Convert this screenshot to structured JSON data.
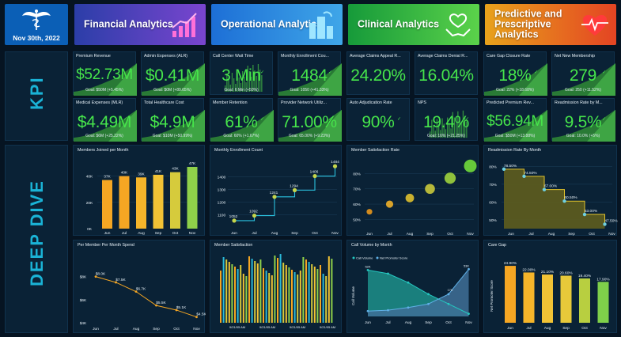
{
  "header": {
    "date": "Nov 30th, 2022",
    "tabs": [
      {
        "label": "Financial Analytics",
        "colors": [
          "#2b3ea8",
          "#7a45cf"
        ],
        "icon": "growth-chart-icon"
      },
      {
        "label": "Operational Analytics",
        "colors": [
          "#1d6fd6",
          "#3fa6e8"
        ],
        "icon": "buildings-icon"
      },
      {
        "label": "Clinical Analytics",
        "colors": [
          "#169a3a",
          "#5bd24a"
        ],
        "icon": "heart-hands-icon"
      },
      {
        "label": "Predictive and Prescriptive Analytics",
        "colors": [
          "#e8a21b",
          "#e44423"
        ],
        "icon": "heartbeat-icon"
      }
    ]
  },
  "sections": {
    "kpi": "KPI",
    "deep_dive": "DEEP DIVE"
  },
  "kpis": [
    {
      "title": "Premium Revenue",
      "value": "$52.73M",
      "goal": "Goal: $50M (+5.45%)",
      "spark": "area"
    },
    {
      "title": "Admin Expenses (ALR)",
      "value": "$0.41M",
      "goal": "Goal: $0M (+89.65%)",
      "spark": "area"
    },
    {
      "title": "Call Center Wait Time",
      "value": "3 Min",
      "goal": "Goal: 6 Min (+50%)",
      "spark": "bars"
    },
    {
      "title": "Monthly Enrollment Cou...",
      "value": "1484",
      "goal": "Goal: 1050 (+41.33%)",
      "spark": "area"
    },
    {
      "title": "Average Claims Appeal R...",
      "value": "24.20%",
      "goal": "",
      "spark": "none"
    },
    {
      "title": "Average Claims Denial R...",
      "value": "16.04%",
      "goal": "",
      "spark": "none"
    },
    {
      "title": "Care Gap Closure Rate",
      "value": "18%",
      "goal": "Goal: 22% (+18.68%)",
      "spark": "area"
    },
    {
      "title": "Net New Membership",
      "value": "279",
      "goal": "Goal: 250 (+11.52%)",
      "spark": "area"
    },
    {
      "title": "Medical Expenses (MLR)",
      "value": "$4.49M",
      "goal": "Goal: $6M (+25.22%)",
      "spark": "area"
    },
    {
      "title": "Total Healthcare Cost",
      "value": "$4.9M",
      "goal": "Goal: $10M (+50.99%)",
      "spark": "area"
    },
    {
      "title": "Member Retention",
      "value": "61%",
      "goal": "Goal: 60% (+1.67%)",
      "spark": "area"
    },
    {
      "title": "Provider Network Utiliz...",
      "value": "71.00%",
      "goal": "Goal: 65.00% (+9.23%)",
      "spark": "area"
    },
    {
      "title": "Auto Adjudication Rate",
      "value": "90%",
      "goal": "",
      "spark": "none"
    },
    {
      "title": "NPS",
      "value": "19.4%",
      "goal": "Goal: 16% (+21.25%)",
      "spark": "bars"
    },
    {
      "title": "Predicted Premium Rev...",
      "value": "$56.94M",
      "goal": "Goal: $50M (+13.88%)",
      "spark": "area"
    },
    {
      "title": "Readmission Rate by M...",
      "value": "9.5%",
      "goal": "Goal: 10.0% (+5%)",
      "spark": "area"
    }
  ],
  "chart_data": [
    {
      "id": "members-joined",
      "type": "bar",
      "title": "Members Joined per Month",
      "categories": [
        "Jun",
        "Jul",
        "Aug",
        "Sep",
        "Oct",
        "Nov"
      ],
      "values": [
        37,
        40,
        39,
        41,
        43,
        47
      ],
      "value_labels": [
        "37K",
        "40K",
        "39K",
        "41K",
        "43K",
        "47K"
      ],
      "yticks": [
        "40K",
        "20K",
        "0K"
      ],
      "ylim": [
        0,
        50
      ]
    },
    {
      "id": "monthly-enrollment",
      "type": "line",
      "title": "Monthly Enrollment Count",
      "categories": [
        "Jun",
        "Jul",
        "Aug",
        "Sep",
        "Oct",
        "Nov"
      ],
      "values": [
        1052,
        1092,
        1241,
        1294,
        1406,
        1484
      ],
      "yticks": [
        "1400",
        "1300",
        "1200",
        "1100"
      ],
      "ylim": [
        1020,
        1510
      ]
    },
    {
      "id": "member-satisfaction-rate",
      "type": "scatter",
      "title": "Member Satisfaction Rate",
      "categories": [
        "Jun",
        "Jul",
        "Aug",
        "Sep",
        "Oct",
        "Nov"
      ],
      "values": [
        55,
        60,
        64,
        70,
        77,
        85
      ],
      "yticks": [
        "80%",
        "70%",
        "60%",
        "50%"
      ],
      "ylim": [
        45,
        88
      ]
    },
    {
      "id": "readmission-rate",
      "type": "area",
      "title": "Readmission Rate By Month",
      "categories": [
        "Jun",
        "Jul",
        "Aug",
        "Sep",
        "Oct",
        "Nov"
      ],
      "values": [
        78.5,
        74.5,
        67.0,
        60.5,
        53.0,
        47.5
      ],
      "value_labels": [
        "78.50%",
        "74.50%",
        "67.00%",
        "60.50%",
        "53.00%",
        "47.50%"
      ],
      "yticks": [
        "80%",
        "70%",
        "60%",
        "50%"
      ],
      "ylim": [
        45,
        82
      ]
    },
    {
      "id": "per-member-per-month",
      "type": "line",
      "title": "Per Member Per Month Spend",
      "categories": [
        "Jun",
        "Jul",
        "Aug",
        "Sep",
        "Oct",
        "Nov"
      ],
      "values": [
        8.0,
        7.5,
        6.7,
        5.5,
        5.1,
        4.5
      ],
      "value_labels": [
        "$8.0K",
        "$7.5K",
        "$6.7K",
        "$5.5K",
        "$5.1K",
        "$4.5K"
      ],
      "yticks": [
        "$8K",
        "$6K",
        "$4K"
      ],
      "ylim": [
        4,
        8.8
      ]
    },
    {
      "id": "member-satisfaction",
      "type": "bar",
      "title": "Member Satisfaction",
      "xticks": [
        "9/21/05 AM",
        "9/21/05 AM",
        "9/21/05 AM",
        "9/21/05 AM"
      ]
    },
    {
      "id": "call-volume",
      "type": "area",
      "title": "Call Volume by Month",
      "series": [
        {
          "name": "Call Volume",
          "values": [
            52,
            48,
            38,
            25,
            14,
            3
          ]
        },
        {
          "name": "Net Promoter Score",
          "values": [
            6,
            7,
            10,
            14,
            25,
            53
          ]
        }
      ],
      "value_labels": [
        "52K",
        "",
        "",
        "",
        "17K",
        "53K"
      ],
      "ylabel": "Call Volume",
      "categories": [
        "Jun",
        "Jul",
        "Aug",
        "Sep",
        "Oct",
        "Nov"
      ]
    },
    {
      "id": "care-gap",
      "type": "bar",
      "title": "Care Gap",
      "categories": [
        "Jun",
        "Jul",
        "Aug",
        "Sep",
        "Oct",
        "Nov"
      ],
      "values": [
        24.9,
        22.0,
        21.1,
        20.6,
        19.4,
        17.9
      ],
      "value_labels": [
        "24.90%",
        "22.00%",
        "21.10%",
        "20.60%",
        "19.40%",
        "17.90%"
      ],
      "ylabel": "Net Promoter Score",
      "ylim": [
        0,
        27
      ]
    }
  ],
  "colors": {
    "green": "#46e54b",
    "accent": "#1ab3d6",
    "orange": "#f5a623",
    "card": "#0a2236"
  }
}
